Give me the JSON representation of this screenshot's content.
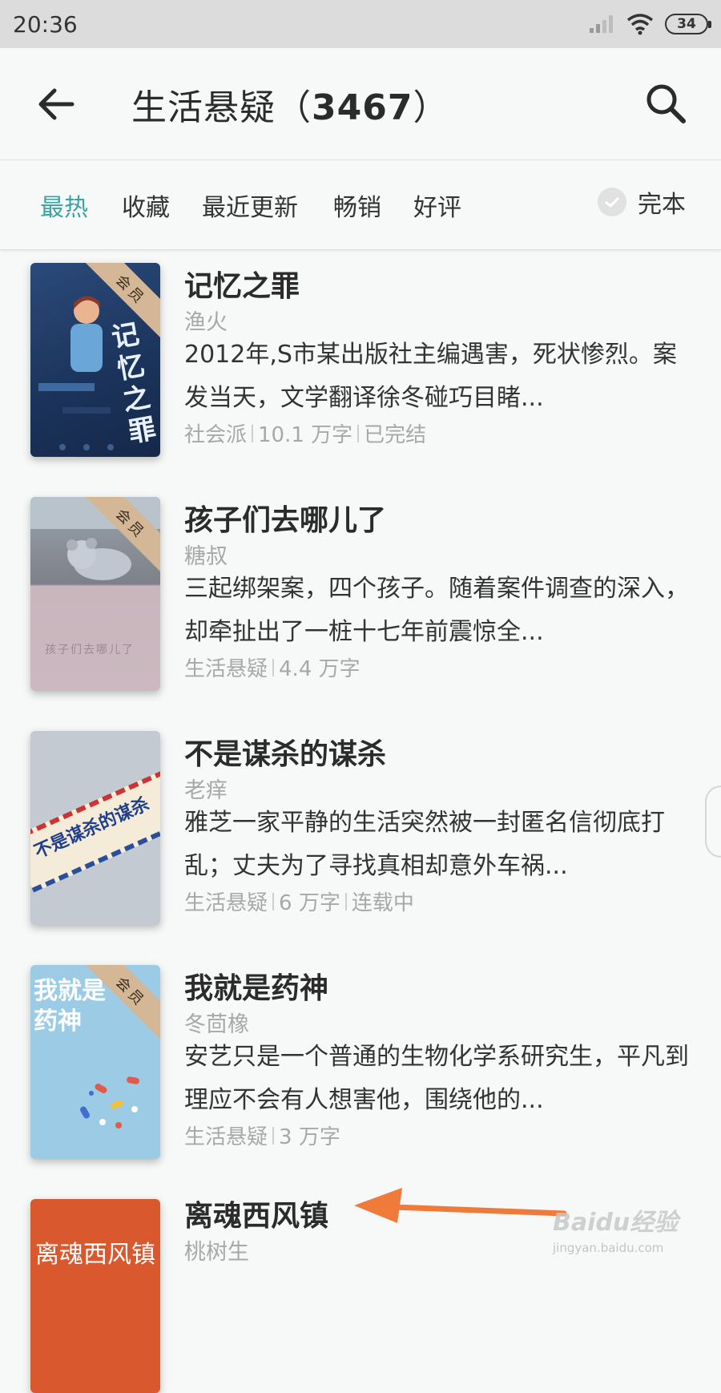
{
  "status_bar": {
    "time": "20:36",
    "battery": "34"
  },
  "header": {
    "title": "生活悬疑（",
    "count": "3467",
    "close": "）"
  },
  "filters": {
    "tabs": [
      "最热",
      "收藏",
      "最近更新",
      "畅销",
      "好评"
    ],
    "active_tab": "最热",
    "complete_label": "完本"
  },
  "books": [
    {
      "title": "记忆之罪",
      "author": "渔火",
      "description": "2012年,S市某出版社主编遇害，死状惨烈。案发当天，文学翻译徐冬碰巧目睹...",
      "meta": [
        "社会派",
        "10.1 万字",
        "已完结"
      ],
      "badge": "会员",
      "cover_text": "记忆之罪"
    },
    {
      "title": "孩子们去哪儿了",
      "author": "糖叔",
      "description": "三起绑架案，四个孩子。随着案件调查的深入，却牵扯出了一桩十七年前震惊全...",
      "meta": [
        "生活悬疑",
        "4.4 万字"
      ],
      "badge": "会员",
      "cover_text": "孩子们去哪儿了"
    },
    {
      "title": "不是谋杀的谋杀",
      "author": "老痒",
      "description": "雅芝一家平静的生活突然被一封匿名信彻底打乱；丈夫为了寻找真相却意外车祸...",
      "meta": [
        "生活悬疑",
        "6 万字",
        "连载中"
      ],
      "badge": "",
      "cover_text": "不是谋杀的谋杀"
    },
    {
      "title": "我就是药神",
      "author": "冬茴橡",
      "description": "安艺只是一个普通的生物化学系研究生，平凡到理应不会有人想害他，围绕他的...",
      "meta": [
        "生活悬疑",
        "3 万字"
      ],
      "badge": "会员",
      "cover_text": "我就是药神"
    },
    {
      "title": "离魂西风镇",
      "author": "桃树生",
      "description": "",
      "meta": [],
      "badge": "",
      "cover_text": "离魂西风镇"
    }
  ],
  "watermark": {
    "brand": "Baidu经验",
    "url": "jingyan.baidu.com"
  },
  "colors": {
    "accent": "#3aa3a3",
    "arrow": "#f07a3a",
    "badge": "#d4b796"
  }
}
